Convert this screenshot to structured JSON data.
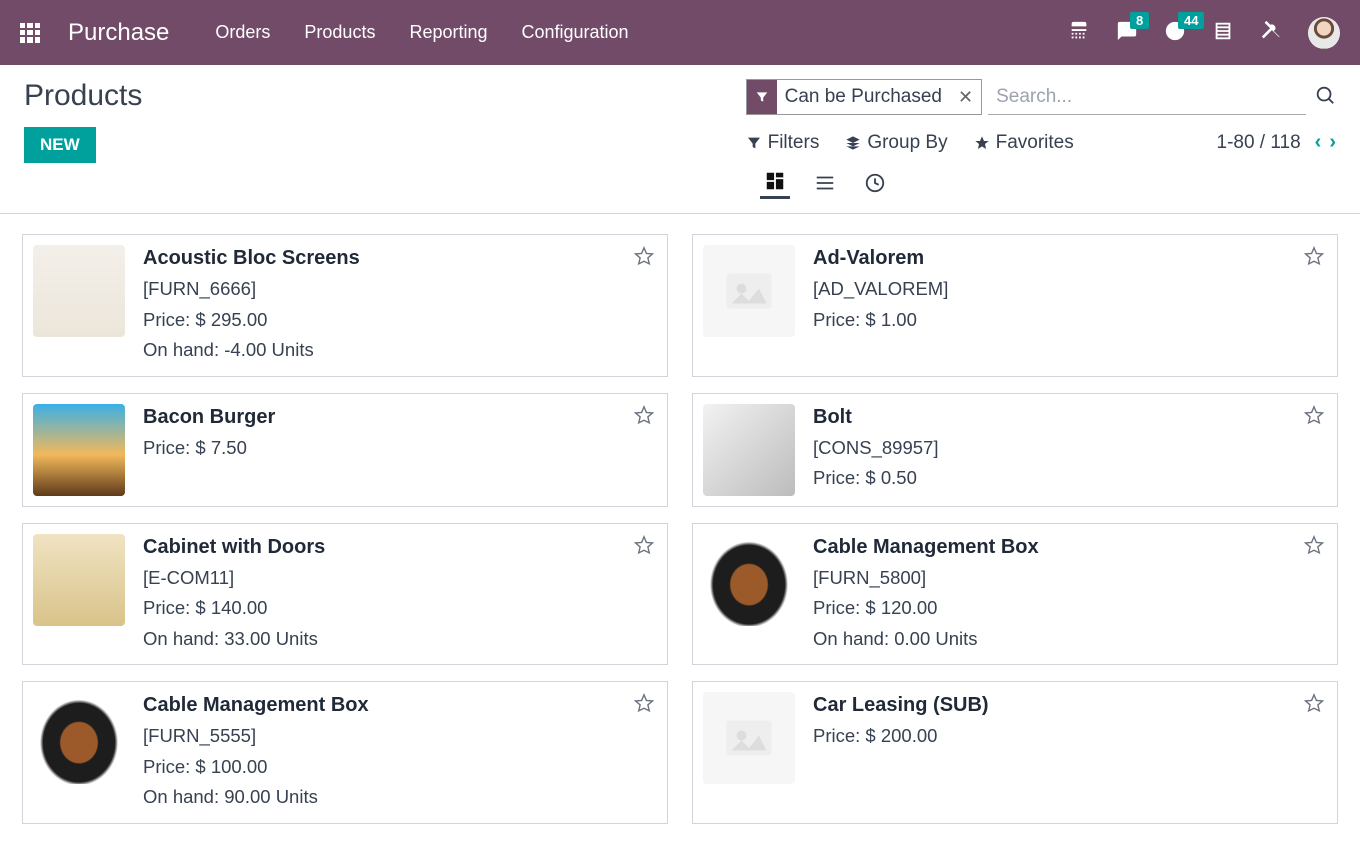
{
  "nav": {
    "app_title": "Purchase",
    "links": [
      "Orders",
      "Products",
      "Reporting",
      "Configuration"
    ],
    "badges": {
      "messages": "8",
      "activities": "44"
    }
  },
  "page": {
    "title": "Products",
    "new_label": "NEW"
  },
  "search": {
    "facet_label": "Can be Purchased",
    "placeholder": "Search..."
  },
  "toolbar": {
    "filters": "Filters",
    "group_by": "Group By",
    "favorites": "Favorites",
    "pager": "1-80 / 118"
  },
  "products": [
    {
      "name": "Acoustic Bloc Screens",
      "ref": "[FURN_6666]",
      "price": "Price: $ 295.00",
      "onhand": "On hand: -4.00 Units",
      "thumb": "screens"
    },
    {
      "name": "Ad-Valorem",
      "ref": "[AD_VALOREM]",
      "price": "Price: $ 1.00",
      "onhand": "",
      "thumb": "placeholder"
    },
    {
      "name": "Bacon Burger",
      "ref": "",
      "price": "Price: $ 7.50",
      "onhand": "",
      "thumb": "burger"
    },
    {
      "name": "Bolt",
      "ref": "[CONS_89957]",
      "price": "Price: $ 0.50",
      "onhand": "",
      "thumb": "bolt"
    },
    {
      "name": "Cabinet with Doors",
      "ref": "[E-COM11]",
      "price": "Price: $ 140.00",
      "onhand": "On hand: 33.00 Units",
      "thumb": "cabinet"
    },
    {
      "name": "Cable Management Box",
      "ref": "[FURN_5800]",
      "price": "Price: $ 120.00",
      "onhand": "On hand: 0.00 Units",
      "thumb": "cablebox"
    },
    {
      "name": "Cable Management Box",
      "ref": "[FURN_5555]",
      "price": "Price: $ 100.00",
      "onhand": "On hand: 90.00 Units",
      "thumb": "cablebox"
    },
    {
      "name": "Car Leasing (SUB)",
      "ref": "",
      "price": "Price: $ 200.00",
      "onhand": "",
      "thumb": "placeholder"
    }
  ]
}
